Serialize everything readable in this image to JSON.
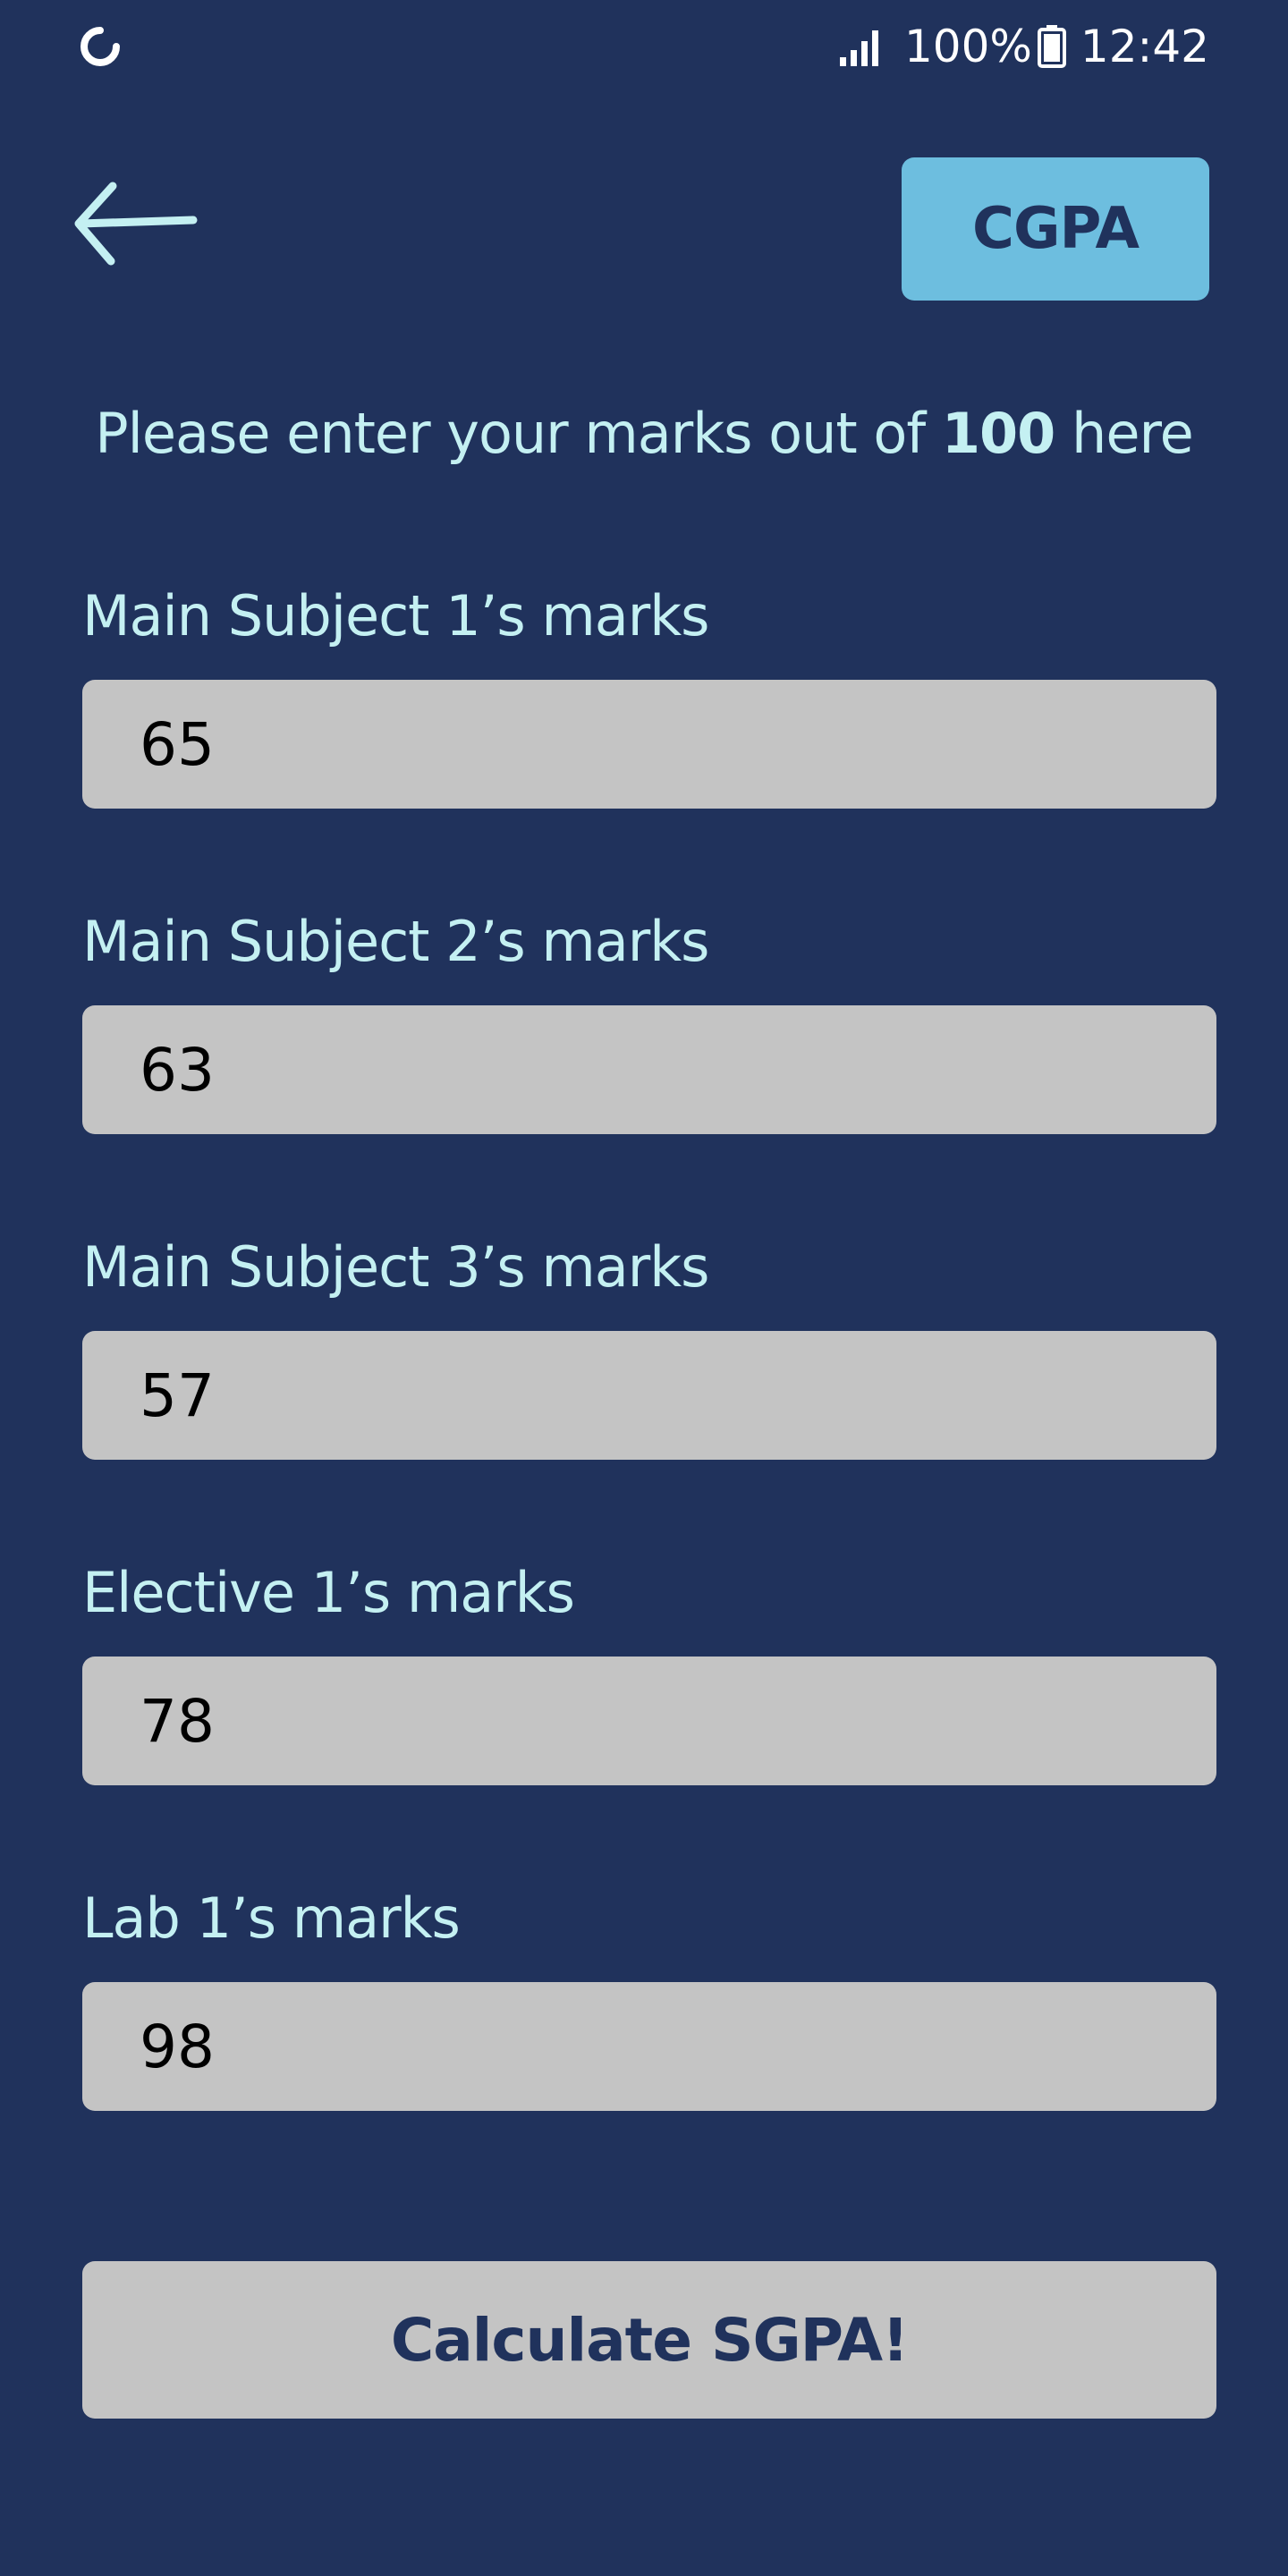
{
  "status_bar": {
    "battery": "100%",
    "time": "12:42",
    "icons": [
      "loading-spinner-icon",
      "signal-icon",
      "battery-icon"
    ]
  },
  "header": {
    "back_icon": "arrow-left-icon",
    "cgpa_label": "CGPA"
  },
  "instruction": {
    "prefix": "Please enter your marks out of ",
    "max_marks": "100",
    "suffix": " here"
  },
  "fields": [
    {
      "label": "Main Subject 1’s marks",
      "value": "65"
    },
    {
      "label": "Main Subject 2’s marks",
      "value": "63"
    },
    {
      "label": "Main Subject 3’s marks",
      "value": "57"
    },
    {
      "label": "Elective 1’s marks",
      "value": "78"
    },
    {
      "label": "Lab 1’s marks",
      "value": "98"
    }
  ],
  "calculate_label": "Calculate SGPA!",
  "colors": {
    "background": "#20325c",
    "accent": "#6dbedf",
    "label_text": "#c4f0f2",
    "input_bg": "#c4c4c4"
  }
}
